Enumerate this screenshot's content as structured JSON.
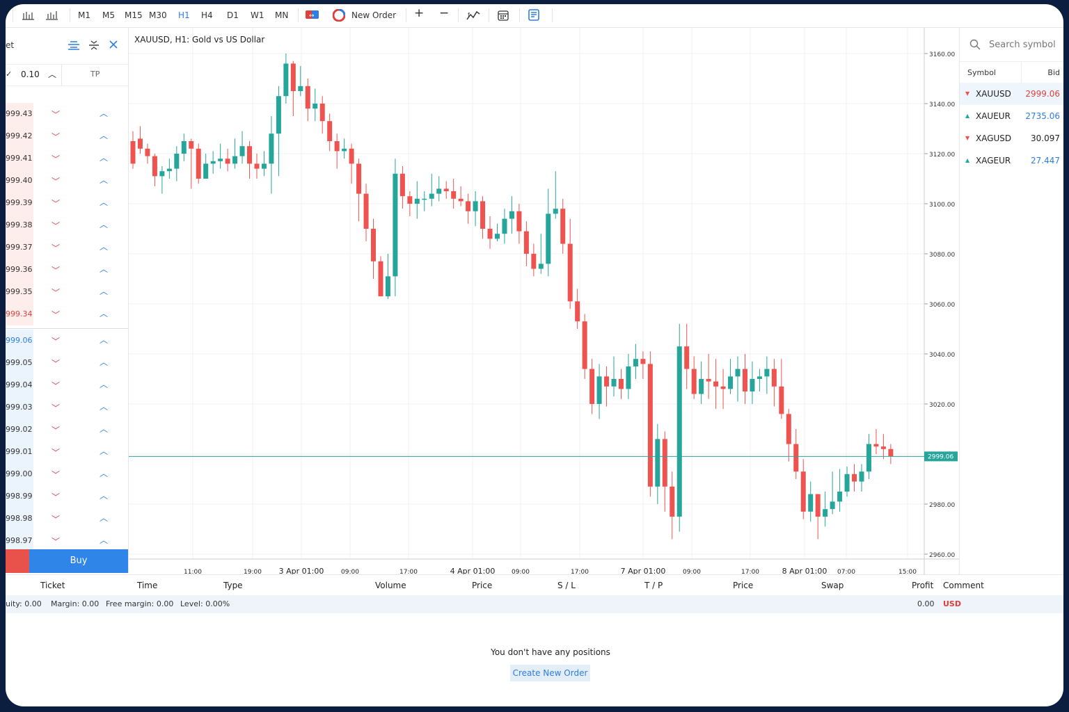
{
  "toolbar": {
    "timeframes": [
      "M1",
      "M5",
      "M15",
      "M30",
      "H1",
      "H4",
      "D1",
      "W1",
      "MN"
    ],
    "active_timeframe": "H1",
    "new_order": "New Order",
    "icons": [
      "bar-chart-icon",
      "candles-icon",
      "one-click-trading-icon",
      "new-order-icon",
      "zoom-in-icon",
      "zoom-out-icon",
      "indicators-icon",
      "calendar-icon",
      "journal-icon"
    ]
  },
  "left_panel": {
    "title_fragment": "et",
    "volume": "0.10",
    "tp_label": "TP",
    "ask_prices": [
      "999.43",
      "999.42",
      "999.41",
      "999.40",
      "999.39",
      "999.38",
      "999.37",
      "999.36",
      "999.35",
      "999.34"
    ],
    "bid_prices": [
      "999.06",
      "999.05",
      "999.04",
      "999.03",
      "999.02",
      "999.01",
      "999.00",
      "998.99",
      "998.98",
      "998.97"
    ],
    "buy_label": "Buy"
  },
  "chart": {
    "title": "XAUUSD, H1: Gold vs US Dollar",
    "current_price_label": "2999.06"
  },
  "chart_data": {
    "type": "candlestick",
    "title": "XAUUSD, H1: Gold vs US Dollar",
    "y_ticks": [
      "3160.00",
      "3140.00",
      "3120.00",
      "3100.00",
      "3080.00",
      "3060.00",
      "3040.00",
      "3020.00",
      "3000.00",
      "2980.00",
      "2960.00"
    ],
    "ylim": [
      2956,
      3167
    ],
    "x_ticks": [
      "11:00",
      "19:00",
      "3 Apr 01:00",
      "09:00",
      "17:00",
      "4 Apr 01:00",
      "09:00",
      "17:00",
      "7 Apr 01:00",
      "09:00",
      "17:00",
      "8 Apr 01:00",
      "07:00",
      "15:00"
    ],
    "current_price": 2999.06,
    "candles": [
      [
        3125,
        3116,
        3129,
        3114
      ],
      [
        3126,
        3122,
        3131,
        3120
      ],
      [
        3122,
        3119,
        3124,
        3116
      ],
      [
        3119,
        3111,
        3120,
        3107
      ],
      [
        3111,
        3113,
        3115,
        3104
      ],
      [
        3113,
        3114,
        3118,
        3110
      ],
      [
        3114,
        3120,
        3123,
        3109
      ],
      [
        3120,
        3125,
        3128,
        3117
      ],
      [
        3125,
        3122,
        3126,
        3106
      ],
      [
        3122,
        3110,
        3124,
        3108
      ],
      [
        3110,
        3116,
        3120,
        3111
      ],
      [
        3116,
        3117,
        3121,
        3112
      ],
      [
        3117,
        3118,
        3124,
        3114
      ],
      [
        3118,
        3116,
        3122,
        3113
      ],
      [
        3116,
        3119,
        3126,
        3114
      ],
      [
        3119,
        3123,
        3129,
        3116
      ],
      [
        3123,
        3116,
        3125,
        3110
      ],
      [
        3116,
        3114,
        3120,
        3110
      ],
      [
        3114,
        3116,
        3121,
        3111
      ],
      [
        3116,
        3128,
        3135,
        3104
      ],
      [
        3128,
        3143,
        3147,
        3111
      ],
      [
        3143,
        3156,
        3160,
        3140
      ],
      [
        3156,
        3145,
        3157,
        3135
      ],
      [
        3145,
        3147,
        3155,
        3143
      ],
      [
        3147,
        3138,
        3150,
        3133
      ],
      [
        3138,
        3140,
        3146,
        3133
      ],
      [
        3140,
        3133,
        3143,
        3128
      ],
      [
        3133,
        3125,
        3136,
        3121
      ],
      [
        3125,
        3121,
        3128,
        3114
      ],
      [
        3121,
        3122,
        3126,
        3118
      ],
      [
        3122,
        3116,
        3124,
        3108
      ],
      [
        3116,
        3104,
        3118,
        3093
      ],
      [
        3104,
        3090,
        3108,
        3085
      ],
      [
        3090,
        3077,
        3094,
        3070
      ],
      [
        3077,
        3063,
        3079,
        3063
      ],
      [
        3063,
        3071,
        3080,
        3062
      ],
      [
        3071,
        3112,
        3118,
        3063
      ],
      [
        3112,
        3103,
        3115,
        3098
      ],
      [
        3103,
        3100,
        3105,
        3095
      ],
      [
        3100,
        3102,
        3109,
        3094
      ],
      [
        3102,
        3102,
        3105,
        3097
      ],
      [
        3102,
        3104,
        3112,
        3099
      ],
      [
        3104,
        3106,
        3111,
        3101
      ],
      [
        3106,
        3105,
        3109,
        3102
      ],
      [
        3105,
        3102,
        3110,
        3098
      ],
      [
        3102,
        3101,
        3107,
        3099
      ],
      [
        3101,
        3097,
        3104,
        3092
      ],
      [
        3097,
        3101,
        3105,
        3091
      ],
      [
        3101,
        3090,
        3103,
        3086
      ],
      [
        3090,
        3086,
        3095,
        3082
      ],
      [
        3086,
        3088,
        3092,
        3085
      ],
      [
        3088,
        3094,
        3098,
        3084
      ],
      [
        3094,
        3097,
        3103,
        3088
      ],
      [
        3097,
        3089,
        3100,
        3084
      ],
      [
        3089,
        3080,
        3093,
        3075
      ],
      [
        3080,
        3074,
        3084,
        3071
      ],
      [
        3074,
        3076,
        3088,
        3072
      ],
      [
        3076,
        3096,
        3106,
        3071
      ],
      [
        3096,
        3098,
        3113,
        3094
      ],
      [
        3098,
        3084,
        3102,
        3080
      ],
      [
        3084,
        3061,
        3094,
        3058
      ],
      [
        3061,
        3053,
        3066,
        3050
      ],
      [
        3053,
        3034,
        3056,
        3030
      ],
      [
        3034,
        3020,
        3038,
        3016
      ],
      [
        3020,
        3031,
        3036,
        3014
      ],
      [
        3031,
        3027,
        3035,
        3019
      ],
      [
        3027,
        3030,
        3039,
        3023
      ],
      [
        3030,
        3026,
        3034,
        3022
      ],
      [
        3026,
        3035,
        3040,
        3022
      ],
      [
        3035,
        3038,
        3044,
        3030
      ],
      [
        3038,
        3036,
        3041,
        3030
      ],
      [
        3036,
        2987,
        3041,
        2983
      ],
      [
        2987,
        3006,
        3012,
        2980
      ],
      [
        3006,
        2987,
        3009,
        2977
      ],
      [
        2987,
        2975,
        2993,
        2966
      ],
      [
        2975,
        3043,
        3052,
        2969
      ],
      [
        3043,
        3034,
        3052,
        3026
      ],
      [
        3034,
        3024,
        3039,
        3022
      ],
      [
        3024,
        3030,
        3037,
        3020
      ],
      [
        3030,
        3029,
        3040,
        3022
      ],
      [
        3029,
        3027,
        3038,
        3018
      ],
      [
        3027,
        3026,
        3034,
        3018
      ],
      [
        3026,
        3031,
        3038,
        3024
      ],
      [
        3031,
        3034,
        3039,
        3021
      ],
      [
        3034,
        3025,
        3040,
        3020
      ],
      [
        3025,
        3030,
        3037,
        3020
      ],
      [
        3030,
        3031,
        3034,
        3025
      ],
      [
        3031,
        3034,
        3039,
        3024
      ],
      [
        3034,
        3027,
        3038,
        3019
      ],
      [
        3027,
        3016,
        3038,
        3014
      ],
      [
        3016,
        3004,
        3018,
        2997
      ],
      [
        3004,
        2993,
        3010,
        2990
      ],
      [
        2993,
        2977,
        2998,
        2974
      ],
      [
        2977,
        2984,
        2989,
        2973
      ],
      [
        2984,
        2975,
        2984,
        2966
      ],
      [
        2975,
        2978,
        2985,
        2971
      ],
      [
        2978,
        2981,
        2993,
        2976
      ],
      [
        2981,
        2985,
        2994,
        2977
      ],
      [
        2985,
        2992,
        2995,
        2983
      ],
      [
        2992,
        2989,
        2996,
        2985
      ],
      [
        2989,
        2993,
        2996,
        2985
      ],
      [
        2993,
        3004,
        3008,
        2990
      ],
      [
        3004,
        3003,
        3010,
        3000
      ],
      [
        3003,
        3002,
        3008,
        2998
      ],
      [
        3002,
        2999,
        3004,
        2996
      ]
    ]
  },
  "watchlist": {
    "search_placeholder": "Search symbol",
    "col_symbol": "Symbol",
    "col_bid": "Bid",
    "rows": [
      {
        "symbol": "XAUUSD",
        "bid": "2999.06",
        "dir": "down",
        "color": "#e0403a"
      },
      {
        "symbol": "XAUEUR",
        "bid": "2735.06",
        "dir": "up",
        "color": "#2f7de1"
      },
      {
        "symbol": "XAGUSD",
        "bid": "30.097",
        "dir": "down",
        "color": "#222222"
      },
      {
        "symbol": "XAGEUR",
        "bid": "27.447",
        "dir": "up",
        "color": "#2f7de1"
      }
    ]
  },
  "positions": {
    "columns": [
      "Ticket",
      "Time",
      "Type",
      "Volume",
      "Price",
      "S / L",
      "T / P",
      "Price",
      "Swap",
      "Profit",
      "Comment"
    ],
    "equity": "uity: 0.00",
    "margin": "Margin: 0.00",
    "free_margin": "Free margin: 0.00",
    "level": "Level: 0.00%",
    "total_profit": "0.00",
    "currency": "USD",
    "empty_text": "You don't have any positions",
    "create_label": "Create New Order"
  },
  "colors": {
    "up": "#26a69a",
    "down": "#ef5350",
    "accent": "#2f7de1"
  }
}
